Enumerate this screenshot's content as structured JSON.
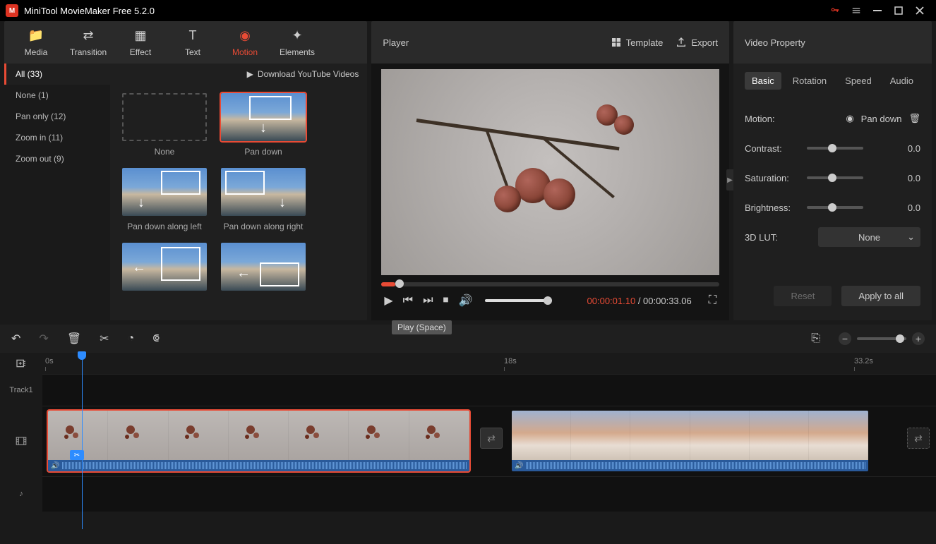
{
  "titlebar": {
    "app_title": "MiniTool MovieMaker Free 5.2.0"
  },
  "tabs": {
    "media": "Media",
    "transition": "Transition",
    "effect": "Effect",
    "text": "Text",
    "motion": "Motion",
    "elements": "Elements"
  },
  "library": {
    "download_yt": "Download YouTube Videos",
    "categories": [
      {
        "label": "All (33)",
        "active": true
      },
      {
        "label": "None (1)"
      },
      {
        "label": "Pan only (12)"
      },
      {
        "label": "Zoom in (11)"
      },
      {
        "label": "Zoom out (9)"
      }
    ],
    "items": [
      {
        "label": "None"
      },
      {
        "label": "Pan down",
        "selected": true
      },
      {
        "label": "Pan down along left"
      },
      {
        "label": "Pan down along right"
      },
      {
        "label": ""
      },
      {
        "label": ""
      }
    ]
  },
  "player": {
    "title": "Player",
    "template": "Template",
    "export": "Export",
    "time_current": "00:00:01.10",
    "time_sep": " / ",
    "time_total": "00:00:33.06",
    "tooltip": "Play (Space)"
  },
  "props": {
    "title": "Video Property",
    "tabs": {
      "basic": "Basic",
      "rotation": "Rotation",
      "speed": "Speed",
      "audio": "Audio"
    },
    "motion_label": "Motion:",
    "motion_value": "Pan down",
    "contrast_label": "Contrast:",
    "contrast_value": "0.0",
    "saturation_label": "Saturation:",
    "saturation_value": "0.0",
    "brightness_label": "Brightness:",
    "brightness_value": "0.0",
    "lut_label": "3D LUT:",
    "lut_value": "None",
    "reset": "Reset",
    "apply": "Apply to all"
  },
  "timeline": {
    "ruler": {
      "t0": "0s",
      "t1": "18s",
      "t2": "33.2s"
    },
    "track1": "Track1"
  }
}
